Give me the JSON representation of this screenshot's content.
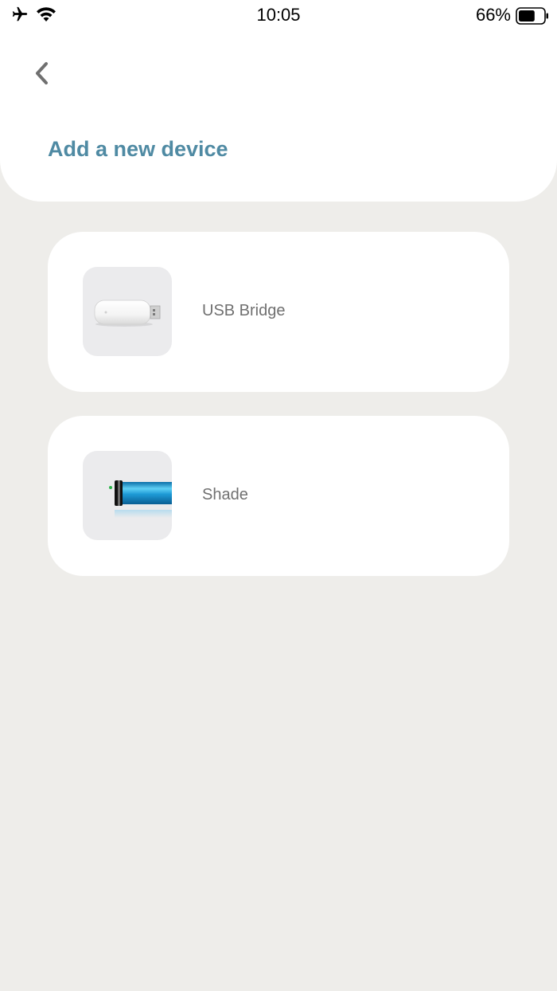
{
  "status_bar": {
    "time": "10:05",
    "battery_percent": "66%",
    "battery_level": 0.66,
    "icons": [
      "airplane-icon",
      "wifi-icon",
      "battery-icon"
    ]
  },
  "header": {
    "back_icon": "chevron-left-icon",
    "title": "Add a new device"
  },
  "devices": [
    {
      "label": "USB Bridge",
      "icon": "usb-bridge-icon"
    },
    {
      "label": "Shade",
      "icon": "shade-roller-icon"
    }
  ],
  "colors": {
    "title": "#4f8aa3",
    "background": "#eeedea",
    "card": "#ffffff",
    "shade_blue": "#1e9ad6"
  }
}
